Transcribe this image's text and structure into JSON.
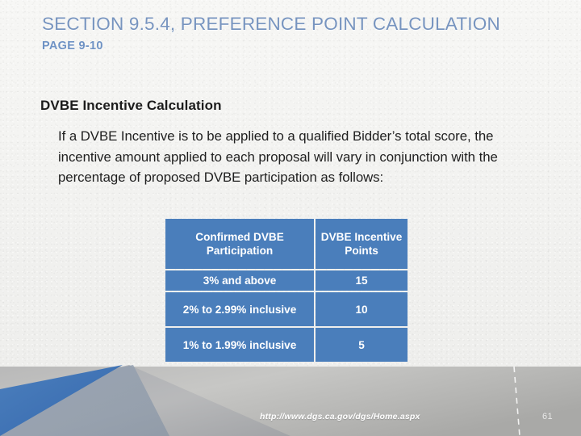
{
  "slide": {
    "title": "SECTION 9.5.4, PREFERENCE POINT CALCULATION",
    "subtitle": "PAGE 9-10",
    "body_heading": "DVBE Incentive Calculation",
    "body_paragraph": "If a DVBE Incentive is to be applied to a qualified Bidder’s total score, the incentive amount applied to each proposal will vary in conjunction with the percentage of proposed DVBE participation as follows:"
  },
  "table": {
    "headers": [
      "Confirmed DVBE Participation",
      "DVBE Incentive Points"
    ],
    "rows": [
      {
        "participation": "3% and above",
        "points": "15"
      },
      {
        "participation": "2% to 2.99% inclusive",
        "points": "10"
      },
      {
        "participation": "1% to 1.99% inclusive",
        "points": "5"
      }
    ]
  },
  "footer": {
    "url": "http://www.dgs.ca.gov/dgs/Home.aspx",
    "page_number": "61"
  },
  "colors": {
    "title_blue": "#7794bf",
    "subtitle_blue": "#6e92c4",
    "table_blue": "#4a7ebb",
    "accent_triangle_blue": "#3f72b4",
    "background": "#f2f2f0",
    "body_text": "#1f1f1f"
  }
}
